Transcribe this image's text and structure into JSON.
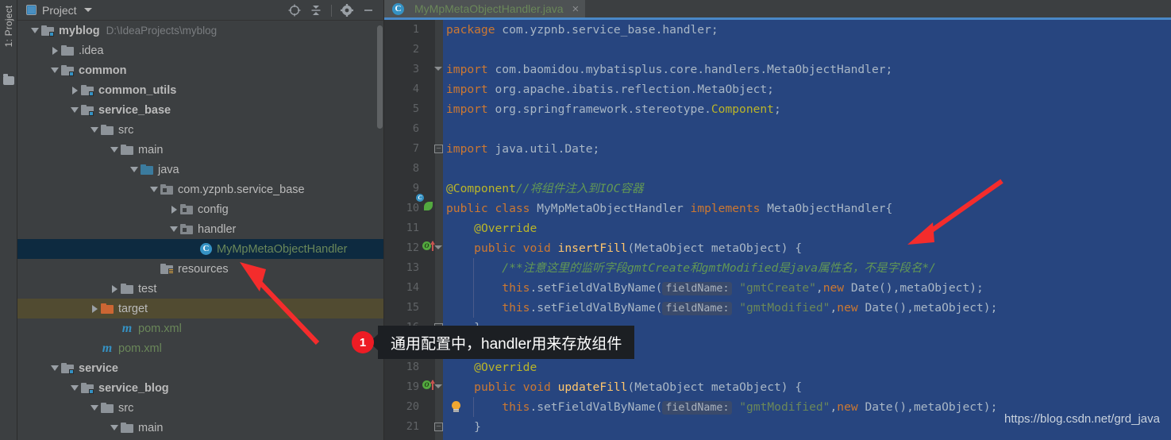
{
  "tool_window": {
    "vertical_label": "1: Project",
    "title": "Project",
    "actions": [
      {
        "name": "locate-icon",
        "label": "Select Opened File"
      },
      {
        "name": "collapse-all-icon",
        "label": "Collapse All"
      },
      {
        "name": "gear-icon",
        "label": "Settings"
      },
      {
        "name": "minimize-icon",
        "label": "Hide"
      }
    ]
  },
  "tree": {
    "items": [
      {
        "label": "myblog",
        "path": "D:\\IdeaProjects\\myblog",
        "indent": 0,
        "arrow": "down",
        "icon": "module-folder-icon",
        "bold": true,
        "state": "normal"
      },
      {
        "label": ".idea",
        "path": "",
        "indent": 1,
        "arrow": "right",
        "icon": "folder-icon",
        "bold": false,
        "state": "normal"
      },
      {
        "label": "common",
        "path": "",
        "indent": 1,
        "arrow": "down",
        "icon": "module-folder-icon",
        "bold": true,
        "state": "normal"
      },
      {
        "label": "common_utils",
        "path": "",
        "indent": 2,
        "arrow": "right",
        "icon": "module-folder-icon",
        "bold": true,
        "state": "normal"
      },
      {
        "label": "service_base",
        "path": "",
        "indent": 2,
        "arrow": "down",
        "icon": "module-folder-icon",
        "bold": true,
        "state": "normal"
      },
      {
        "label": "src",
        "path": "",
        "indent": 3,
        "arrow": "down",
        "icon": "folder-icon",
        "bold": false,
        "state": "normal"
      },
      {
        "label": "main",
        "path": "",
        "indent": 4,
        "arrow": "down",
        "icon": "folder-icon",
        "bold": false,
        "state": "normal"
      },
      {
        "label": "java",
        "path": "",
        "indent": 5,
        "arrow": "down",
        "icon": "source-folder-icon",
        "bold": false,
        "state": "normal"
      },
      {
        "label": "com.yzpnb.service_base",
        "path": "",
        "indent": 6,
        "arrow": "down",
        "icon": "package-icon",
        "bold": false,
        "state": "normal"
      },
      {
        "label": "config",
        "path": "",
        "indent": 7,
        "arrow": "right",
        "icon": "package-icon",
        "bold": false,
        "state": "normal"
      },
      {
        "label": "handler",
        "path": "",
        "indent": 7,
        "arrow": "down",
        "icon": "package-icon",
        "bold": false,
        "state": "normal"
      },
      {
        "label": "MyMpMetaObjectHandler",
        "path": "",
        "indent": 8,
        "arrow": "none",
        "icon": "java-class-icon",
        "bold": false,
        "state": "selected"
      },
      {
        "label": "resources",
        "path": "",
        "indent": 6,
        "arrow": "none",
        "icon": "resources-folder-icon",
        "bold": false,
        "state": "normal"
      },
      {
        "label": "test",
        "path": "",
        "indent": 4,
        "arrow": "right",
        "icon": "folder-icon",
        "bold": false,
        "state": "normal"
      },
      {
        "label": "target",
        "path": "",
        "indent": 3,
        "arrow": "right",
        "icon": "target-folder-icon",
        "bold": false,
        "state": "highlighted"
      },
      {
        "label": "pom.xml",
        "path": "",
        "indent": 4,
        "arrow": "none",
        "icon": "maven-icon",
        "bold": false,
        "state": "normal"
      },
      {
        "label": "pom.xml",
        "path": "",
        "indent": 3,
        "arrow": "none",
        "icon": "maven-icon",
        "bold": false,
        "state": "normal"
      },
      {
        "label": "service",
        "path": "",
        "indent": 1,
        "arrow": "down",
        "icon": "module-folder-icon",
        "bold": true,
        "state": "normal"
      },
      {
        "label": "service_blog",
        "path": "",
        "indent": 2,
        "arrow": "down",
        "icon": "module-folder-icon",
        "bold": true,
        "state": "normal"
      },
      {
        "label": "src",
        "path": "",
        "indent": 3,
        "arrow": "down",
        "icon": "folder-icon",
        "bold": false,
        "state": "normal"
      },
      {
        "label": "main",
        "path": "",
        "indent": 4,
        "arrow": "down",
        "icon": "folder-icon",
        "bold": false,
        "state": "normal"
      }
    ]
  },
  "editor": {
    "tab": {
      "label": "MyMpMetaObjectHandler.java",
      "close": "×",
      "icon": "java-class-icon"
    },
    "watermark": "https://blog.csdn.net/grd_java",
    "lines": [
      {
        "n": "1",
        "gutter": "",
        "fold": "",
        "tokens": [
          {
            "t": "package ",
            "c": "kw"
          },
          {
            "t": "com.yzpnb.service_base.handler;",
            "c": "plain"
          }
        ]
      },
      {
        "n": "2",
        "gutter": "",
        "fold": "",
        "tokens": []
      },
      {
        "n": "3",
        "gutter": "",
        "fold": "fold-start",
        "tokens": [
          {
            "t": "import ",
            "c": "kw"
          },
          {
            "t": "com.baomidou.mybatisplus.core.handlers.MetaObjectHandler;",
            "c": "plain"
          }
        ]
      },
      {
        "n": "4",
        "gutter": "",
        "fold": "",
        "tokens": [
          {
            "t": "import ",
            "c": "kw"
          },
          {
            "t": "org.apache.ibatis.reflection.MetaObject;",
            "c": "plain"
          }
        ]
      },
      {
        "n": "5",
        "gutter": "",
        "fold": "",
        "tokens": [
          {
            "t": "import ",
            "c": "kw"
          },
          {
            "t": "org.springframework.stereotype.",
            "c": "plain"
          },
          {
            "t": "Component",
            "c": "anno"
          },
          {
            "t": ";",
            "c": "plain"
          }
        ]
      },
      {
        "n": "6",
        "gutter": "",
        "fold": "",
        "tokens": []
      },
      {
        "n": "7",
        "gutter": "",
        "fold": "fold-end",
        "tokens": [
          {
            "t": "import ",
            "c": "kw"
          },
          {
            "t": "java.util.Date;",
            "c": "plain"
          }
        ]
      },
      {
        "n": "8",
        "gutter": "",
        "fold": "",
        "tokens": []
      },
      {
        "n": "9",
        "gutter": "",
        "fold": "",
        "tokens": [
          {
            "t": "@Component",
            "c": "anno"
          },
          {
            "t": "//将组件注入到IOC容器",
            "c": "cmt"
          }
        ]
      },
      {
        "n": "10",
        "gutter": "spring-bean-icon",
        "fold": "",
        "tokens": [
          {
            "t": "public ",
            "c": "kw"
          },
          {
            "t": "class ",
            "c": "kw"
          },
          {
            "t": "MyMpMetaObjectHandler ",
            "c": "plain"
          },
          {
            "t": "implements ",
            "c": "kw"
          },
          {
            "t": "MetaObjectHandler{",
            "c": "plain"
          }
        ]
      },
      {
        "n": "11",
        "gutter": "",
        "fold": "",
        "tokens": [
          {
            "t": "    ",
            "c": "plain"
          },
          {
            "t": "@Override",
            "c": "anno"
          }
        ]
      },
      {
        "n": "12",
        "gutter": "override-icon",
        "fold": "fold-start",
        "tokens": [
          {
            "t": "    ",
            "c": "plain"
          },
          {
            "t": "public ",
            "c": "kw"
          },
          {
            "t": "void ",
            "c": "kw"
          },
          {
            "t": "insertFill",
            "c": "fn"
          },
          {
            "t": "(MetaObject metaObject) {",
            "c": "plain"
          }
        ]
      },
      {
        "n": "13",
        "gutter": "",
        "fold": "",
        "tokens": [
          {
            "t": "        ",
            "c": "plain"
          },
          {
            "t": "/**注意这里的监听字段gmtCreate和gmtModified是java属性名，不是字段名*/",
            "c": "cmt"
          }
        ]
      },
      {
        "n": "14",
        "gutter": "",
        "fold": "",
        "tokens": [
          {
            "t": "        ",
            "c": "plain"
          },
          {
            "t": "this",
            "c": "kw"
          },
          {
            "t": ".setFieldValByName(",
            "c": "plain"
          },
          {
            "t": "fieldName:",
            "c": "hint"
          },
          {
            "t": " ",
            "c": "plain"
          },
          {
            "t": "\"gmtCreate\"",
            "c": "str"
          },
          {
            "t": ",",
            "c": "plain"
          },
          {
            "t": "new ",
            "c": "kw"
          },
          {
            "t": "Date(),metaObject);",
            "c": "plain"
          }
        ]
      },
      {
        "n": "15",
        "gutter": "",
        "fold": "",
        "tokens": [
          {
            "t": "        ",
            "c": "plain"
          },
          {
            "t": "this",
            "c": "kw"
          },
          {
            "t": ".setFieldValByName(",
            "c": "plain"
          },
          {
            "t": "fieldName:",
            "c": "hint"
          },
          {
            "t": " ",
            "c": "plain"
          },
          {
            "t": "\"gmtModified\"",
            "c": "str"
          },
          {
            "t": ",",
            "c": "plain"
          },
          {
            "t": "new ",
            "c": "kw"
          },
          {
            "t": "Date(),metaObject);",
            "c": "plain"
          }
        ]
      },
      {
        "n": "16",
        "gutter": "",
        "fold": "fold-end",
        "tokens": [
          {
            "t": "    }",
            "c": "plain"
          }
        ]
      },
      {
        "n": "17",
        "gutter": "",
        "fold": "",
        "tokens": []
      },
      {
        "n": "18",
        "gutter": "",
        "fold": "",
        "tokens": [
          {
            "t": "    ",
            "c": "plain"
          },
          {
            "t": "@Override",
            "c": "anno"
          }
        ]
      },
      {
        "n": "19",
        "gutter": "override-icon",
        "fold": "fold-start",
        "tokens": [
          {
            "t": "    ",
            "c": "plain"
          },
          {
            "t": "public ",
            "c": "kw"
          },
          {
            "t": "void ",
            "c": "kw"
          },
          {
            "t": "updateFill",
            "c": "fn"
          },
          {
            "t": "(MetaObject metaObject) {",
            "c": "plain"
          }
        ]
      },
      {
        "n": "20",
        "gutter": "bulb-icon",
        "fold": "",
        "tokens": [
          {
            "t": "        ",
            "c": "plain"
          },
          {
            "t": "this",
            "c": "kw"
          },
          {
            "t": ".setFieldValByName(",
            "c": "plain"
          },
          {
            "t": "fieldName:",
            "c": "hint"
          },
          {
            "t": " ",
            "c": "plain"
          },
          {
            "t": "\"gmtModified\"",
            "c": "str"
          },
          {
            "t": ",",
            "c": "plain"
          },
          {
            "t": "new ",
            "c": "kw"
          },
          {
            "t": "Date(),metaObject);",
            "c": "plain"
          }
        ]
      },
      {
        "n": "21",
        "gutter": "",
        "fold": "fold-end",
        "tokens": [
          {
            "t": "    }",
            "c": "plain"
          }
        ]
      }
    ]
  },
  "annotations": {
    "callout_text": "通用配置中，handler用来存放组件",
    "badge_number": "1",
    "arrow_color": "#f42c2c"
  },
  "colors": {
    "panel_bg": "#3c3f41",
    "editor_selection_bg": "#27457f",
    "tree_selection_bg": "#0d2a40",
    "tab_accent": "#4a88c7",
    "annotation_red": "#ed1c24"
  }
}
